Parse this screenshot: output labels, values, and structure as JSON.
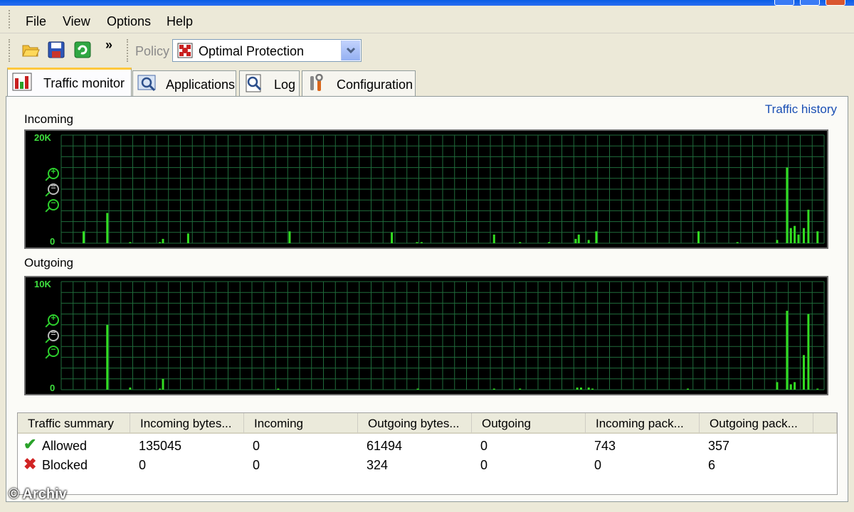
{
  "menu": [
    "File",
    "View",
    "Options",
    "Help"
  ],
  "toolbar": {
    "icons": [
      "open-folder-icon",
      "save-icon",
      "refresh-icon"
    ],
    "overflow_glyph": "»",
    "policy_label": "Policy",
    "policy_value": "Optimal Protection"
  },
  "tabs": [
    {
      "label": "Traffic monitor",
      "icon": "traffic-chart-icon",
      "active": true
    },
    {
      "label": "Applications",
      "icon": "applications-icon",
      "active": false
    },
    {
      "label": "Log",
      "icon": "log-icon",
      "active": false
    },
    {
      "label": "Configuration",
      "icon": "configuration-icon",
      "active": false
    }
  ],
  "traffic_history_link": "Traffic history",
  "charts": {
    "incoming": {
      "label": "Incoming",
      "ymax_label": "20K",
      "ymin_label": "0",
      "bar_color": "#33dd22",
      "grid_color": "#1f6b3b",
      "values": [
        {
          "x": 0.028,
          "v": 0.11
        },
        {
          "x": 0.059,
          "v": 0.28
        },
        {
          "x": 0.089,
          "v": 0.01
        },
        {
          "x": 0.128,
          "v": 0.01
        },
        {
          "x": 0.132,
          "v": 0.04
        },
        {
          "x": 0.165,
          "v": 0.09
        },
        {
          "x": 0.298,
          "v": 0.11
        },
        {
          "x": 0.432,
          "v": 0.1
        },
        {
          "x": 0.465,
          "v": 0.01
        },
        {
          "x": 0.471,
          "v": 0.01
        },
        {
          "x": 0.566,
          "v": 0.08
        },
        {
          "x": 0.6,
          "v": 0.01
        },
        {
          "x": 0.638,
          "v": 0.01
        },
        {
          "x": 0.673,
          "v": 0.04
        },
        {
          "x": 0.677,
          "v": 0.08
        },
        {
          "x": 0.69,
          "v": 0.03
        },
        {
          "x": 0.7,
          "v": 0.11
        },
        {
          "x": 0.834,
          "v": 0.11
        },
        {
          "x": 0.885,
          "v": 0.01
        },
        {
          "x": 0.937,
          "v": 0.03
        },
        {
          "x": 0.95,
          "v": 0.7
        },
        {
          "x": 0.955,
          "v": 0.14
        },
        {
          "x": 0.96,
          "v": 0.16
        },
        {
          "x": 0.965,
          "v": 0.08
        },
        {
          "x": 0.972,
          "v": 0.14
        },
        {
          "x": 0.978,
          "v": 0.31
        },
        {
          "x": 0.99,
          "v": 0.11
        }
      ]
    },
    "outgoing": {
      "label": "Outgoing",
      "ymax_label": "10K",
      "ymin_label": "0",
      "bar_color": "#33dd22",
      "grid_color": "#1f6b3b",
      "values": [
        {
          "x": 0.059,
          "v": 0.6
        },
        {
          "x": 0.089,
          "v": 0.02
        },
        {
          "x": 0.128,
          "v": 0.01
        },
        {
          "x": 0.132,
          "v": 0.1
        },
        {
          "x": 0.283,
          "v": 0.01
        },
        {
          "x": 0.466,
          "v": 0.01
        },
        {
          "x": 0.566,
          "v": 0.01
        },
        {
          "x": 0.6,
          "v": 0.01
        },
        {
          "x": 0.675,
          "v": 0.02
        },
        {
          "x": 0.68,
          "v": 0.02
        },
        {
          "x": 0.69,
          "v": 0.02
        },
        {
          "x": 0.695,
          "v": 0.01
        },
        {
          "x": 0.82,
          "v": 0.01
        },
        {
          "x": 0.937,
          "v": 0.07
        },
        {
          "x": 0.95,
          "v": 0.73
        },
        {
          "x": 0.955,
          "v": 0.05
        },
        {
          "x": 0.96,
          "v": 0.07
        },
        {
          "x": 0.972,
          "v": 0.32
        },
        {
          "x": 0.978,
          "v": 0.7
        },
        {
          "x": 0.99,
          "v": 0.01
        }
      ]
    }
  },
  "summary": {
    "columns": [
      "Traffic summary",
      "Incoming bytes...",
      "Incoming",
      "Outgoing bytes...",
      "Outgoing",
      "Incoming pack...",
      "Outgoing pack..."
    ],
    "rows": [
      {
        "icon": "allowed-check-icon",
        "label": "Allowed",
        "cells": [
          "135045",
          "0",
          "61494",
          "0",
          "743",
          "357"
        ]
      },
      {
        "icon": "blocked-x-icon",
        "label": "Blocked",
        "cells": [
          "0",
          "0",
          "324",
          "0",
          "0",
          "6"
        ]
      }
    ]
  },
  "watermark": "© Archiv"
}
